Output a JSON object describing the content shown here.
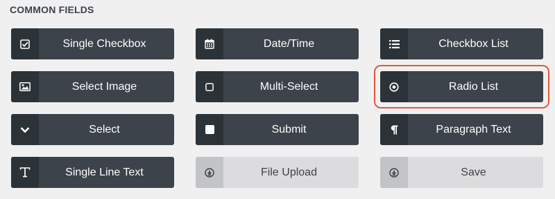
{
  "section": {
    "title": "COMMON FIELDS"
  },
  "fields": [
    {
      "label": "Single Checkbox"
    },
    {
      "label": "Date/Time"
    },
    {
      "label": "Checkbox List"
    },
    {
      "label": "Select Image"
    },
    {
      "label": "Multi-Select"
    },
    {
      "label": "Radio List"
    },
    {
      "label": "Select"
    },
    {
      "label": "Submit"
    },
    {
      "label": "Paragraph Text"
    },
    {
      "label": "Single Line Text"
    },
    {
      "label": "File Upload"
    },
    {
      "label": "Save"
    }
  ],
  "icons": [
    "checkbox-icon",
    "calendar-icon",
    "list-icon",
    "image-icon",
    "square-outline-icon",
    "radio-icon",
    "chevron-down-icon",
    "square-filled-icon",
    "paragraph-icon",
    "text-icon",
    "upload-icon",
    "upload-icon"
  ],
  "colors": {
    "button_bg": "#3c434a",
    "icon_bg": "#2c3338",
    "disabled_bg": "#dcdcde",
    "highlight": "#e0593a"
  }
}
